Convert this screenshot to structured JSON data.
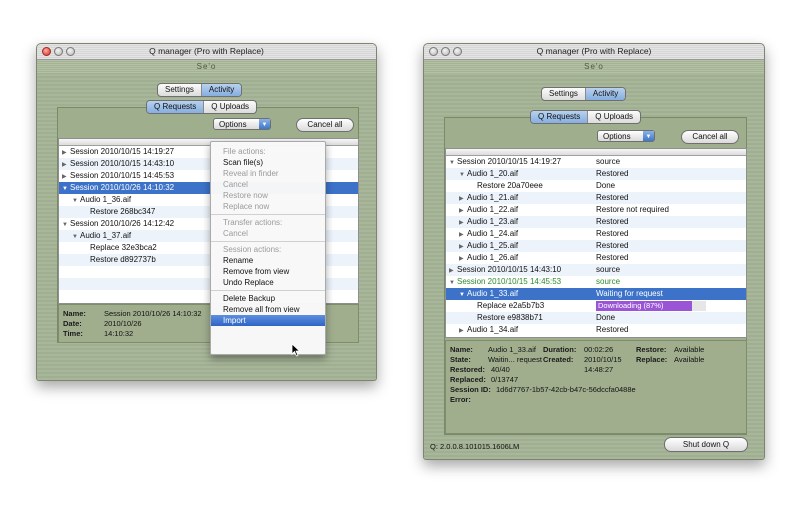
{
  "left": {
    "title": "Q manager (Pro with Replace)",
    "brand": "Se'o",
    "tabs": [
      "Settings",
      "Activity"
    ],
    "subtabs": [
      "Q Requests",
      "Q Uploads"
    ],
    "options_label": "Options",
    "cancel_all": "Cancel all",
    "rows": [
      {
        "text": "Session 2010/10/15 14:19:27",
        "tri": "▶"
      },
      {
        "text": "Session 2010/10/15 14:43:10",
        "tri": "▶"
      },
      {
        "text": "Session 2010/10/15 14:45:53",
        "tri": "▶"
      },
      {
        "text": "Session 2010/10/26 14:10:32",
        "tri": "▼"
      },
      {
        "text": "Audio 1_36.aif",
        "tri": "▼"
      },
      {
        "text": "Restore 268bc347",
        "tri": ""
      },
      {
        "text": "Session 2010/10/26 14:12:42",
        "tri": "▼"
      },
      {
        "text": "Audio 1_37.aif",
        "tri": "▼"
      },
      {
        "text": "Replace 32e3bca2",
        "tri": ""
      },
      {
        "text": "Restore d892737b",
        "tri": ""
      }
    ],
    "menu": {
      "file_header": "File actions:",
      "scan": "Scan file(s)",
      "reveal": "Reveal in finder",
      "cancel": "Cancel",
      "restore_now": "Restore now",
      "replace_now": "Replace now",
      "transfer_header": "Transfer actions:",
      "transfer_cancel": "Cancel",
      "session_header": "Session actions:",
      "rename": "Rename",
      "remove": "Remove from view",
      "undo_replace": "Undo Replace",
      "delete_backup": "Delete Backup",
      "remove_all": "Remove all from view",
      "import": "Import"
    },
    "info": {
      "name_k": "Name:",
      "name_v": "Session 2010/10/26 14:10:32",
      "date_k": "Date:",
      "date_v": "2010/10/26",
      "time_k": "Time:",
      "time_v": "14:10:32"
    }
  },
  "right": {
    "title": "Q manager (Pro with Replace)",
    "brand": "Se'o",
    "tabs": [
      "Settings",
      "Activity"
    ],
    "subtabs": [
      "Q Requests",
      "Q Uploads"
    ],
    "options_label": "Options",
    "cancel_all": "Cancel all",
    "rows": [
      {
        "name": "Session 2010/10/15 14:19:27",
        "status": "source",
        "tri": "▼"
      },
      {
        "name": "Audio 1_20.aif",
        "status": "Restored",
        "tri": "▼"
      },
      {
        "name": "Restore 20a70eee",
        "status": "Done",
        "tri": ""
      },
      {
        "name": "Audio 1_21.aif",
        "status": "Restored",
        "tri": "▶"
      },
      {
        "name": "Audio 1_22.aif",
        "status": "Restore not required",
        "tri": "▶"
      },
      {
        "name": "Audio 1_23.aif",
        "status": "Restored",
        "tri": "▶"
      },
      {
        "name": "Audio 1_24.aif",
        "status": "Restored",
        "tri": "▶"
      },
      {
        "name": "Audio 1_25.aif",
        "status": "Restored",
        "tri": "▶"
      },
      {
        "name": "Audio 1_26.aif",
        "status": "Restored",
        "tri": "▶"
      },
      {
        "name": "Session 2010/10/15 14:43:10",
        "status": "source",
        "tri": "▶"
      },
      {
        "name": "Session 2010/10/15 14:45:53",
        "status": "source",
        "tri": "▼"
      },
      {
        "name": "Audio 1_33.aif",
        "status": "Waiting for request",
        "tri": "▼"
      },
      {
        "name": "Replace e2a5b7b3",
        "status": "Downloading (87%)",
        "tri": ""
      },
      {
        "name": "Restore e9838b71",
        "status": "Done",
        "tri": ""
      },
      {
        "name": "Audio 1_34.aif",
        "status": "Restored",
        "tri": "▶"
      }
    ],
    "progress_fraction": 0.87,
    "info": {
      "name_k": "Name:",
      "name_v": "Audio 1_33.aif",
      "duration_k": "Duration:",
      "duration_v": "00:02:26",
      "restore_k": "Restore:",
      "restore_v": "Available",
      "state_k": "State:",
      "state_v": "Waitin... request",
      "created_k": "Created:",
      "created_v": "2010/10/15",
      "replace_k": "Replace:",
      "replace_v": "Available",
      "restored_k": "Restored:",
      "restored_v": "40/40",
      "time_v": "14:48:27",
      "replaced_k": "Replaced:",
      "replaced_v": "0/13747",
      "session_k": "Session ID:",
      "session_v": "1d6d7767-1b57-42cb-b47c-56dccfa0488e",
      "error_k": "Error:"
    },
    "version": "Q: 2.0.0.8.101015.1606LM",
    "shutdown": "Shut down Q"
  }
}
